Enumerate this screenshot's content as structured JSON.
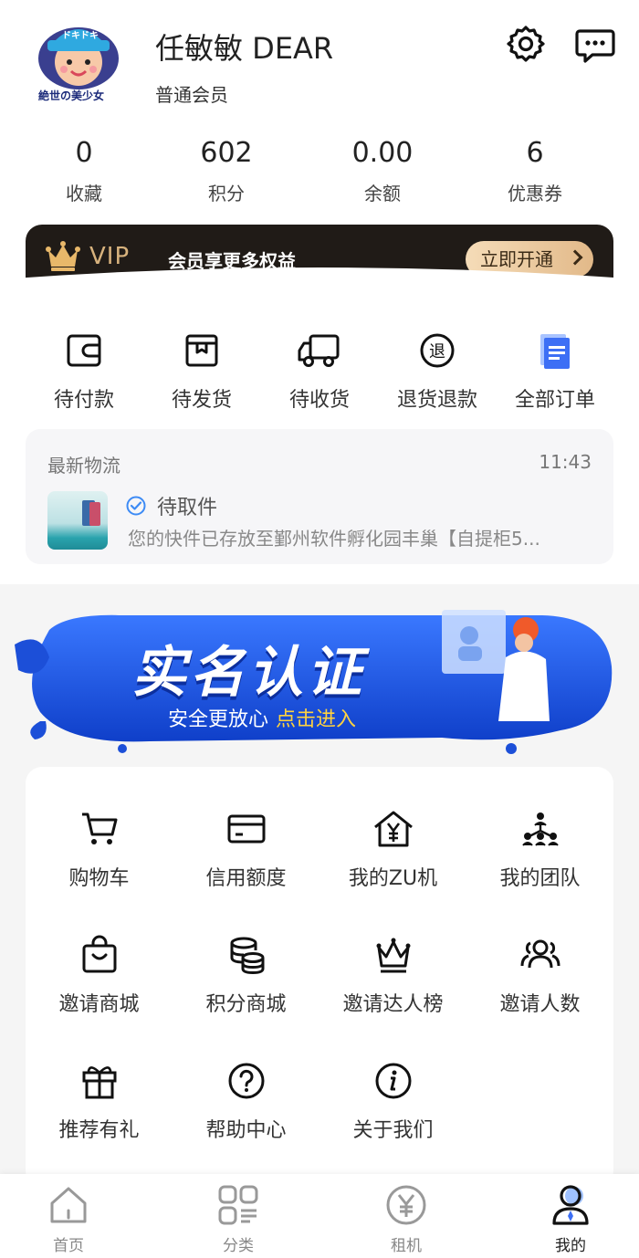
{
  "profile": {
    "avatar_text": "絶世の美少女",
    "avatar_cap": "ドキドキ",
    "name": "任敏敏 DEAR",
    "level": "普通会员"
  },
  "stats": [
    {
      "value": "0",
      "label": "收藏"
    },
    {
      "value": "602",
      "label": "积分"
    },
    {
      "value": "0.00",
      "label": "余额"
    },
    {
      "value": "6",
      "label": "优惠券"
    }
  ],
  "vip": {
    "label": "VIP",
    "desc": "会员享更多权益",
    "button": "立即开通"
  },
  "orders": [
    {
      "label": "待付款",
      "icon": "wallet-icon"
    },
    {
      "label": "待发货",
      "icon": "package-icon"
    },
    {
      "label": "待收货",
      "icon": "truck-icon"
    },
    {
      "label": "退货退款",
      "icon": "refund-icon"
    },
    {
      "label": "全部订单",
      "icon": "document-icon"
    }
  ],
  "logistics": {
    "title": "最新物流",
    "time": "11:43",
    "status": "待取件",
    "message": "您的快件已存放至鄞州软件孵化园丰巢【自提柜5..."
  },
  "banner": {
    "title": "实名认证",
    "sub": "安全更放心",
    "cta": "点击进入"
  },
  "menu": [
    {
      "label": "购物车",
      "icon": "cart-icon"
    },
    {
      "label": "信用额度",
      "icon": "card-icon"
    },
    {
      "label": "我的ZU机",
      "icon": "house-yen-icon"
    },
    {
      "label": "我的团队",
      "icon": "team-icon"
    },
    {
      "label": "邀请商城",
      "icon": "bag-icon"
    },
    {
      "label": "积分商城",
      "icon": "coins-icon"
    },
    {
      "label": "邀请达人榜",
      "icon": "crown-icon"
    },
    {
      "label": "邀请人数",
      "icon": "people-icon"
    },
    {
      "label": "推荐有礼",
      "icon": "gift-icon"
    },
    {
      "label": "帮助中心",
      "icon": "help-icon"
    },
    {
      "label": "关于我们",
      "icon": "info-icon"
    }
  ],
  "tabs": [
    {
      "label": "首页",
      "icon": "home-icon"
    },
    {
      "label": "分类",
      "icon": "category-icon"
    },
    {
      "label": "租机",
      "icon": "yen-icon"
    },
    {
      "label": "我的",
      "icon": "profile-icon"
    }
  ],
  "colors": {
    "vip_bg": "#201b17",
    "vip_gold": "#d7b27d",
    "banner_blue": "#1c4fd8",
    "accent_yellow": "#ffd23f",
    "check_blue": "#3d8bf5"
  }
}
